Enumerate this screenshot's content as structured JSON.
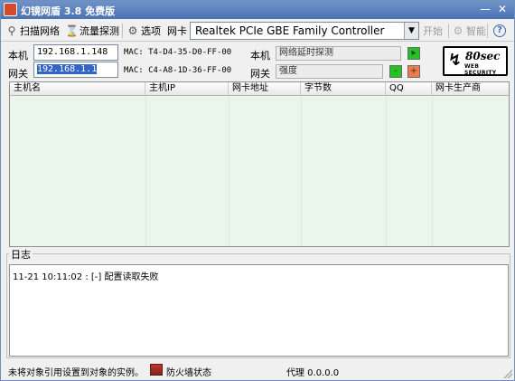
{
  "window": {
    "title": "幻镜网盾 3.8 免费版"
  },
  "toolbar": {
    "scan_label": "扫描网络",
    "traffic_label": "流量探测",
    "options_label": "选项",
    "nic_label": "网卡",
    "nic_value": "Realtek PCIe GBE Family Controller",
    "start_label": "开始",
    "smart_label": "智能"
  },
  "address": {
    "local_label": "本机",
    "local_ip": "192.168.1.148",
    "local_mac": "MAC: T4-D4-35-D0-FF-00",
    "gateway_label": "网关",
    "gateway_ip": "192.168.1.1",
    "gateway_mac": "MAC: C4-A8-1D-36-FF-00",
    "probe_local_label": "本机",
    "probe_local_value": "网络延时探测",
    "probe_gateway_label": "网关",
    "probe_gateway_value": "强度",
    "btn_minus": "-",
    "btn_plus": "+"
  },
  "logo": {
    "text": "80sec",
    "sub": "WEB SECURITY"
  },
  "table": {
    "columns": [
      "主机名",
      "主机IP",
      "网卡地址",
      "字节数",
      "QQ",
      "网卡生产商"
    ]
  },
  "log": {
    "title": "日志",
    "lines": [
      "11-21 10:11:02 : [-] 配置读取失败"
    ]
  },
  "status": {
    "message": "未将对象引用设置到对象的实例。",
    "firewall_label": "防火墙状态",
    "proxy_label": "代理 0.0.0.0"
  },
  "colors": {
    "green_button": "#22c322",
    "orange_button": "#f07a4a",
    "table_bg": "#e9f6e9",
    "title_bar": "#4a73b4"
  }
}
